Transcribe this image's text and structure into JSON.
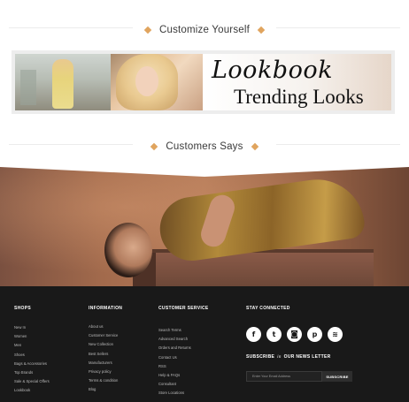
{
  "sections": {
    "customize": {
      "title": "Customize Yourself"
    },
    "customers": {
      "title": "Customers Says"
    }
  },
  "banner": {
    "line1": "Lookbook",
    "line2": "Trending Looks"
  },
  "footer": {
    "shops": {
      "title": "SHOPS",
      "items": [
        "New In",
        "Women",
        "Men",
        "Shoes",
        "Bags & Accessories",
        "Top Brands",
        "Sale & Special Offers",
        "Lookbook"
      ]
    },
    "information": {
      "title": "INFORMATION",
      "items": [
        "About us",
        "Customer Service",
        "New Collection",
        "Best Sellers",
        "Manufacturers",
        "Privacy policy",
        "Terms & condition",
        "Blog"
      ]
    },
    "customer_service": {
      "title": "CUSTOMER SERVICE",
      "items": [
        "Search Terms",
        "Advanced Search",
        "Orders and Returns",
        "Contact Us",
        "RSS",
        "Help & FAQs",
        "Consultant",
        "Store Locations"
      ]
    },
    "stay_connected": {
      "title": "STAY CONNECTED",
      "social": [
        {
          "name": "facebook-icon",
          "glyph": "f"
        },
        {
          "name": "twitter-icon",
          "glyph": "t"
        },
        {
          "name": "instagram-icon",
          "glyph": "◙"
        },
        {
          "name": "pinterest-icon",
          "glyph": "p"
        },
        {
          "name": "rss-icon",
          "glyph": "≋"
        }
      ],
      "newsletter_pre": "SUBSCRIBE",
      "newsletter_mid": "in",
      "newsletter_post": "OUR NEWS LETTER",
      "email_placeholder": "Enter Your Email Address",
      "subscribe_label": "SUBSCRIBE"
    }
  },
  "colors": {
    "accent": "#e0a45e",
    "footer_bg": "#191919"
  }
}
